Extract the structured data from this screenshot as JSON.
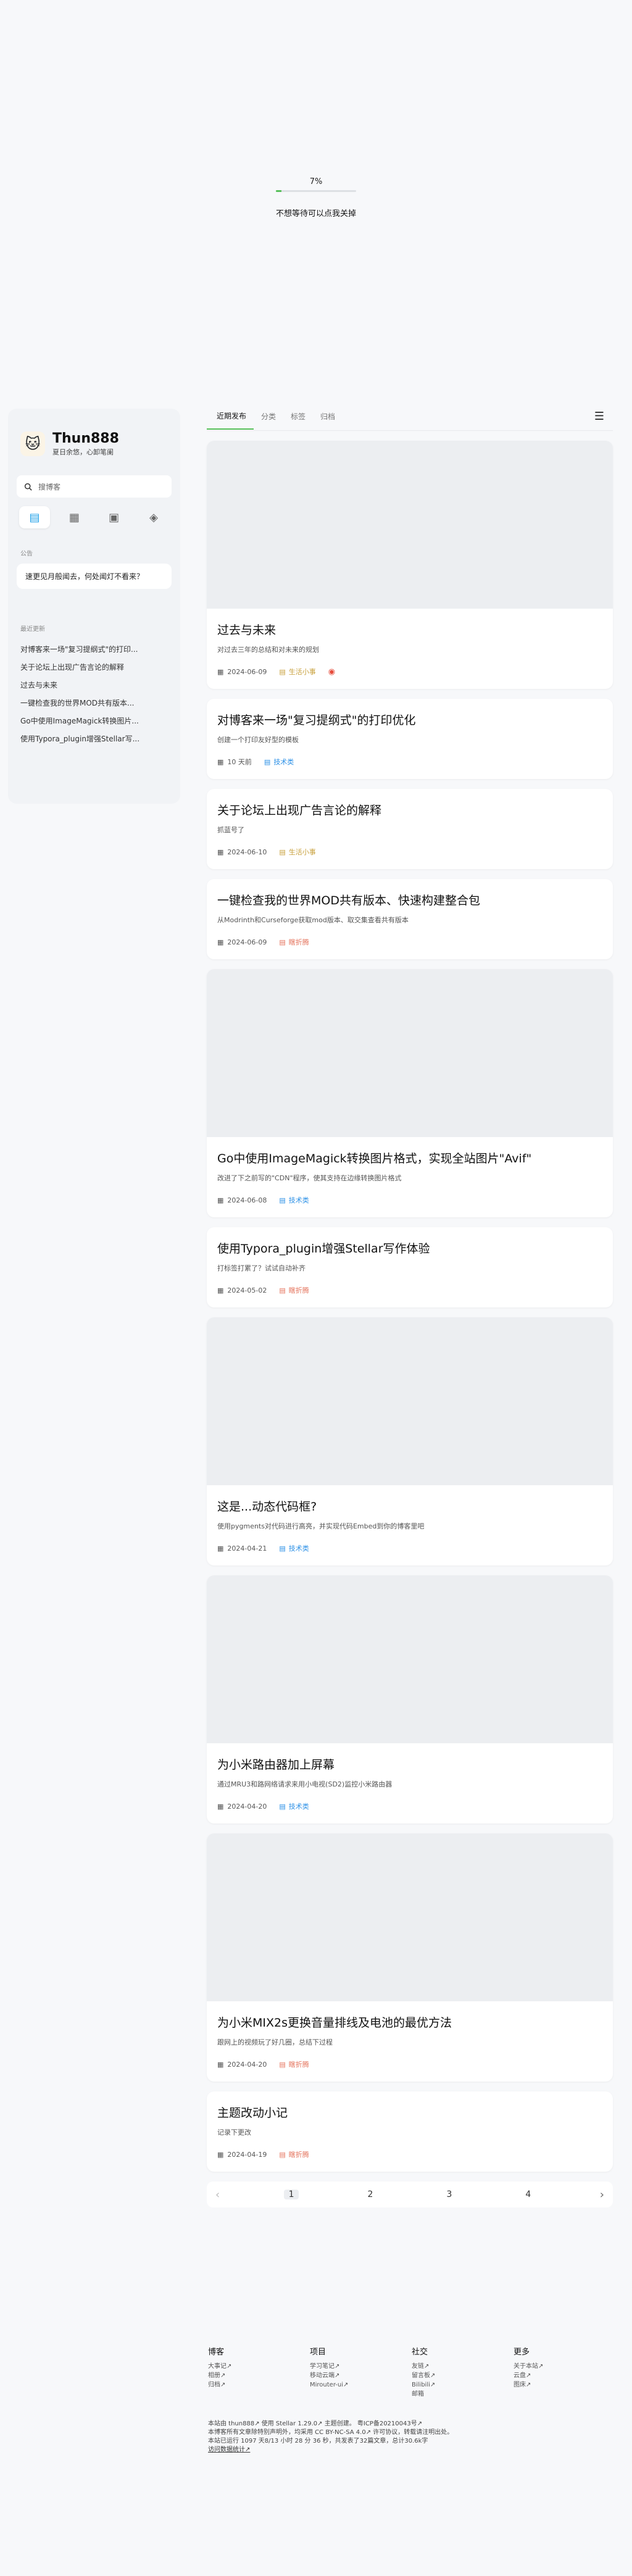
{
  "loader": {
    "percent_text": "7%",
    "progress": 0.07,
    "skip_text": "不想等待可以点我关掉"
  },
  "sidebar": {
    "title": "Thun888",
    "subtitle": "夏日余悠，心卸笔阑",
    "search_placeholder": "搜博客",
    "notice_label": "公告",
    "notice_text": "速更见月般闻去，何处闻灯不看来？",
    "recent_label": "最近更新",
    "recent": [
      "对博客来一场\"复习提纲式\"的打印...",
      "关于论坛上出现广告言论的解释",
      "过去与未来",
      "一键检查我的世界MOD共有版本...",
      "Go中使用ImageMagick转换图片...",
      "使用Typora_plugin增强Stellar写..."
    ]
  },
  "tabs": {
    "items": [
      "近期发布",
      "分类",
      "标签",
      "归档"
    ]
  },
  "posts": [
    {
      "title": "过去与未来",
      "excerpt": "对过去三年的总结和对未来的规划",
      "date": "2024-06-09",
      "category": "生活小事"
    },
    {
      "title": "对博客来一场\"复习提纲式\"的打印优化",
      "excerpt": "创建一个打印友好型的模板",
      "date": "10 天前",
      "category": "技术类"
    },
    {
      "title": "关于论坛上出现广告言论的解释",
      "excerpt": "抓蓝号了",
      "date": "2024-06-10",
      "category": "生活小事"
    },
    {
      "title": "一键检查我的世界MOD共有版本、快速构建整合包",
      "excerpt": "从Modrinth和Curseforge获取mod版本、取交集查看共有版本",
      "date": "2024-06-09",
      "category": "瞎折腾"
    },
    {
      "title": "Go中使用ImageMagick转换图片格式，实现全站图片\"Avif\"",
      "excerpt": "改进了下之前写的\"CDN\"程序，使其支持在边缘转换图片格式",
      "date": "2024-06-08",
      "category": "技术类"
    },
    {
      "title": "使用Typora_plugin增强Stellar写作体验",
      "excerpt": "打标签打累了？试试自动补齐",
      "date": "2024-05-02",
      "category": "瞎折腾"
    },
    {
      "title": "这是...动态代码框?",
      "excerpt": "使用pygments对代码进行高亮，并实现代码Embed到你的博客里吧",
      "date": "2024-04-21",
      "category": "技术类"
    },
    {
      "title": "为小米路由器加上屏幕",
      "excerpt": "通过MRU3和路网络请求来用小电视(SD2)监控小米路由器",
      "date": "2024-04-20",
      "category": "技术类"
    },
    {
      "title": "为小米MIX2s更换音量排线及电池的最优方法",
      "excerpt": "跟网上的视频玩了好几圈，总结下过程",
      "date": "2024-04-20",
      "category": "瞎折腾"
    },
    {
      "title": "主题改动小记",
      "excerpt": "记录下更改",
      "date": "2024-04-19",
      "category": "瞎折腾"
    }
  ],
  "pager": {
    "pages": [
      "1",
      "2",
      "3",
      "4"
    ],
    "prev": "‹",
    "next": "›"
  },
  "footer": {
    "cols": [
      {
        "title": "博客",
        "links": [
          "大事记↗",
          "相册↗",
          "归档↗"
        ]
      },
      {
        "title": "项目",
        "links": [
          "学习笔记↗",
          "移动云端↗",
          "Mirouter-ui↗"
        ]
      },
      {
        "title": "社交",
        "links": [
          "友链↗",
          "留言板↗",
          "Bilibili↗",
          "邮箱"
        ]
      },
      {
        "title": "更多",
        "links": [
          "关于本站↗",
          "云盘↗",
          "图床↗"
        ]
      }
    ],
    "line1": "本站由 thun888↗ 使用 Stellar 1.29.0↗ 主题创建。 粤ICP备20210043号↗",
    "line2": "本博客所有文章除特别声明外，均采用 CC BY-NC-SA 4.0↗ 许可协议，转载请注明出处。",
    "line3": "本站已运行 1097 天8/13 小时 28 分 36 秒，共发表了32篇文章，总计30.6k字",
    "line4": "访问数据统计↗"
  },
  "colors": {
    "accent": "#57c05a",
    "blue_tag": "#2a8fe6",
    "yellow_tag": "#c8a03c",
    "red_tag": "#e4735c"
  }
}
